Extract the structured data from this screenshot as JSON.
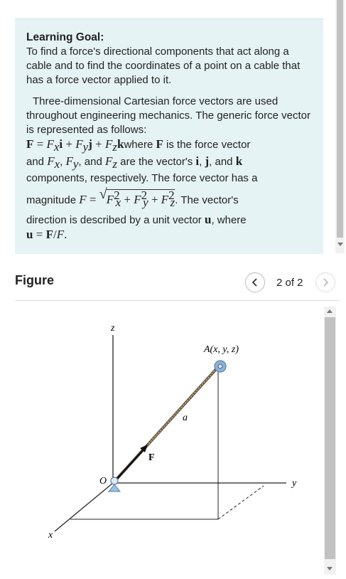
{
  "learning_goal": {
    "title": "Learning Goal:",
    "text": "To find a force's directional components that act along a cable and to find the coordinates of a point on a cable that has a force vector applied to it."
  },
  "intro": {
    "p1": "Three-dimensional Cartesian force vectors are used throughout engineering mechanics. The generic force vector is represented as follows:",
    "where_text": "where",
    "is_force_vector": "is the force vector",
    "and_1": "and",
    "comma_1": ",",
    "and_2": ", and",
    "are_components": "are the vector's",
    "components_text": "components, respectively. The force vector has a",
    "magnitude_text": "magnitude",
    "direction_text": ". The vector's",
    "direction_desc": "direction is described by a unit vector",
    "where_2": ", where"
  },
  "figure": {
    "title": "Figure",
    "page_indicator": "2 of 2",
    "labels": {
      "z": "z",
      "y": "y",
      "x": "x",
      "origin": "O",
      "point": "A(x, y, z)",
      "length": "a",
      "force": "F"
    }
  },
  "icons": {
    "prev": "chevron-left-icon",
    "next": "chevron-right-icon"
  }
}
